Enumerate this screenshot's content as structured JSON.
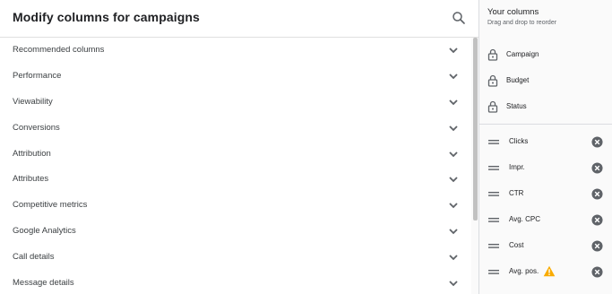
{
  "header": {
    "title": "Modify columns for campaigns"
  },
  "categories": [
    "Recommended columns",
    "Performance",
    "Viewability",
    "Conversions",
    "Attribution",
    "Attributes",
    "Competitive metrics",
    "Google Analytics",
    "Call details",
    "Message details"
  ],
  "your_columns": {
    "title": "Your columns",
    "subtitle": "Drag and drop to reorder",
    "locked": [
      "Campaign",
      "Budget",
      "Status"
    ],
    "movable": [
      {
        "label": "Clicks",
        "warning": false
      },
      {
        "label": "Impr.",
        "warning": false
      },
      {
        "label": "CTR",
        "warning": false
      },
      {
        "label": "Avg. CPC",
        "warning": false
      },
      {
        "label": "Cost",
        "warning": false
      },
      {
        "label": "Avg. pos.",
        "warning": true
      }
    ]
  },
  "colors": {
    "warning": "#f9ab00",
    "remove_icon": "#5f6368",
    "divider": "#dadce0"
  }
}
